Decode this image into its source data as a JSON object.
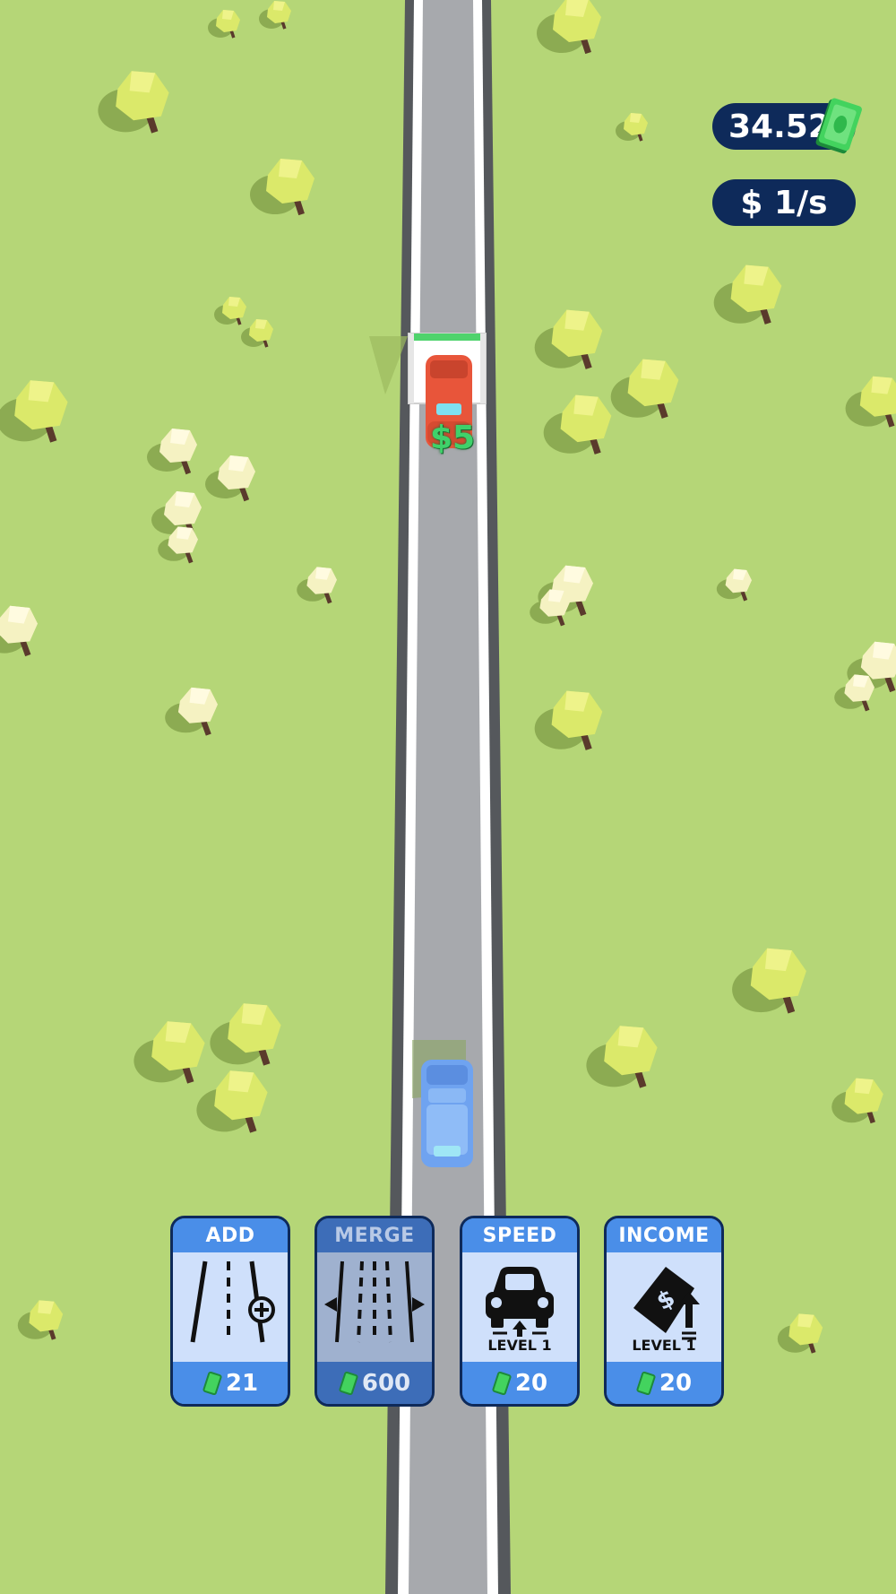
{
  "hud": {
    "money": "34.52",
    "rate": "$ 1/s"
  },
  "road": {
    "earning_popup": "$5"
  },
  "upgrades": [
    {
      "title": "ADD LANE",
      "cost": "21",
      "level": "",
      "enabled": true,
      "icon": "add-lane-icon"
    },
    {
      "title": "MERGE",
      "cost": "600",
      "level": "",
      "enabled": false,
      "icon": "merge-lanes-icon"
    },
    {
      "title": "SPEED",
      "cost": "20",
      "level": "LEVEL 1",
      "enabled": true,
      "icon": "car-speed-icon"
    },
    {
      "title": "INCOME",
      "cost": "20",
      "level": "LEVEL 1",
      "enabled": true,
      "icon": "money-up-icon"
    }
  ],
  "colors": {
    "grass": "#b5d677",
    "road": "#a7a9ad",
    "hud_bg": "#0e2a5a",
    "card_blue": "#4a8ee8",
    "red_car": "#e8553a",
    "blue_car": "#6fa3f0",
    "cash_green": "#3fd16a"
  }
}
